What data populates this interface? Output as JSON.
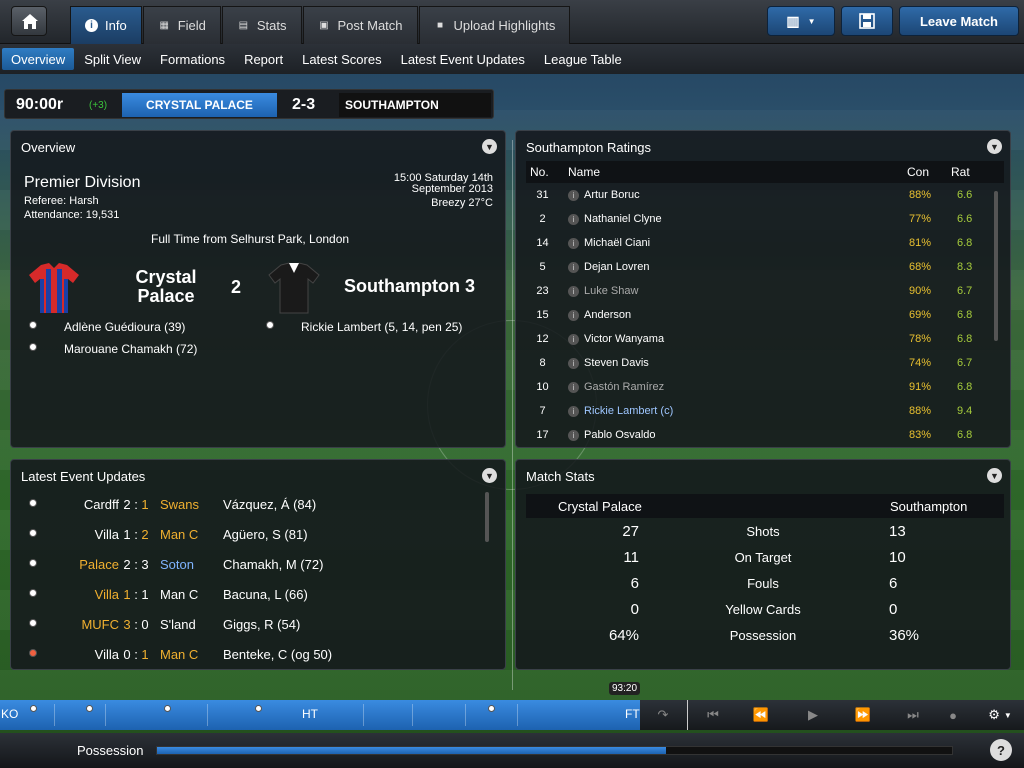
{
  "topbar": {
    "tabs": [
      {
        "label": "Info",
        "icon": "info-icon"
      },
      {
        "label": "Field",
        "icon": "field-icon"
      },
      {
        "label": "Stats",
        "icon": "stats-icon"
      },
      {
        "label": "Post Match",
        "icon": "post-match-icon"
      },
      {
        "label": "Upload Highlights",
        "icon": "video-icon"
      }
    ],
    "leave_label": "Leave Match"
  },
  "subnav": [
    "Overview",
    "Split View",
    "Formations",
    "Report",
    "Latest Scores",
    "Latest Event Updates",
    "League Table"
  ],
  "scorebar": {
    "clock": "90:00r",
    "added": "(+3)",
    "home": "CRYSTAL PALACE",
    "score": "2-3",
    "away": "SOUTHAMPTON"
  },
  "overview": {
    "title": "Overview",
    "competition": "Premier Division",
    "referee": "Referee: Harsh",
    "attendance": "Attendance: 19,531",
    "datetime1": "15:00 Saturday 14th",
    "datetime2": "September 2013",
    "weather": "Breezy 27°C",
    "venue": "Full Time from Selhurst Park, London",
    "home_name1": "Crystal",
    "home_name2": "Palace",
    "home_score": "2",
    "away_name": "Southampton 3",
    "home_scorers": [
      "Adlène Guédioura (39)",
      "Marouane Chamakh (72)"
    ],
    "away_scorers": [
      "Rickie Lambert (5, 14, pen 25)"
    ]
  },
  "ratings": {
    "title": "Southampton Ratings",
    "headers": {
      "no": "No.",
      "name": "Name",
      "con": "Con",
      "rat": "Rat"
    },
    "rows": [
      {
        "no": "31",
        "name": "Artur Boruc",
        "con": "88%",
        "rat": "6.6"
      },
      {
        "no": "2",
        "name": "Nathaniel Clyne",
        "con": "77%",
        "rat": "6.6"
      },
      {
        "no": "14",
        "name": "Michaël Ciani",
        "con": "81%",
        "rat": "6.8"
      },
      {
        "no": "5",
        "name": "Dejan Lovren",
        "con": "68%",
        "rat": "8.3"
      },
      {
        "no": "23",
        "name": "Luke Shaw",
        "con": "90%",
        "rat": "6.7"
      },
      {
        "no": "15",
        "name": "Anderson",
        "con": "69%",
        "rat": "6.8"
      },
      {
        "no": "12",
        "name": "Victor Wanyama",
        "con": "78%",
        "rat": "6.8"
      },
      {
        "no": "8",
        "name": "Steven Davis",
        "con": "74%",
        "rat": "6.7"
      },
      {
        "no": "10",
        "name": "Gastón Ramírez",
        "con": "91%",
        "rat": "6.8"
      },
      {
        "no": "7",
        "name": "Rickie Lambert (c)",
        "con": "88%",
        "rat": "9.4"
      },
      {
        "no": "17",
        "name": "Pablo Osvaldo",
        "con": "83%",
        "rat": "6.8"
      }
    ]
  },
  "events": {
    "title": "Latest Event Updates",
    "rows": [
      {
        "home": "Cardff",
        "hs": "2",
        "as": "1",
        "away": "Swans",
        "scorer": "Vázquez, Á (84)"
      },
      {
        "home": "Villa",
        "hs": "1",
        "as": "2",
        "away": "Man C",
        "scorer": "Agüero, S (81)"
      },
      {
        "home": "Palace",
        "hs": "2",
        "as": "3",
        "away": "Soton",
        "scorer": "Chamakh, M (72)"
      },
      {
        "home": "Villa",
        "hs": "1",
        "as": "1",
        "away": "Man C",
        "scorer": "Bacuna, L (66)"
      },
      {
        "home": "MUFC",
        "hs": "3",
        "as": "0",
        "away": "S'land",
        "scorer": "Giggs, R (54)"
      },
      {
        "home": "Villa",
        "hs": "0",
        "as": "1",
        "away": "Man C",
        "scorer": "Benteke, C (og 50)"
      }
    ]
  },
  "matchstats": {
    "title": "Match Stats",
    "home": "Crystal Palace",
    "away": "Southampton",
    "rows": [
      {
        "l": "27",
        "label": "Shots",
        "r": "13"
      },
      {
        "l": "11",
        "label": "On Target",
        "r": "10"
      },
      {
        "l": "6",
        "label": "Fouls",
        "r": "6"
      },
      {
        "l": "0",
        "label": "Yellow Cards",
        "r": "0"
      },
      {
        "l": "64%",
        "label": "Possession",
        "r": "36%"
      }
    ]
  },
  "timeline": {
    "ko": "KO",
    "ht": "HT",
    "ft": "FT",
    "time": "93:20"
  },
  "bottom": {
    "possession_label": "Possession",
    "possession_home": 0.64,
    "help": "?"
  }
}
